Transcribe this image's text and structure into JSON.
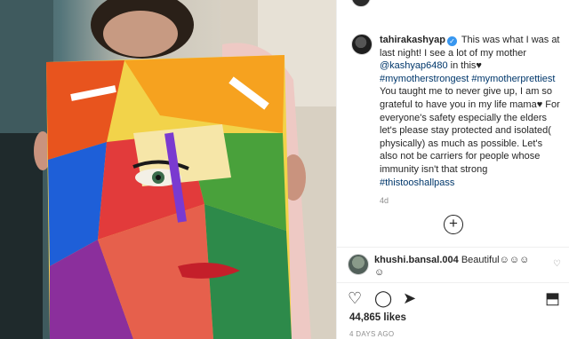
{
  "post": {
    "username": "tahirakashyap",
    "caption_parts": [
      {
        "type": "text",
        "text": " This was what I was at last night! I see a lot of my mother "
      },
      {
        "type": "link",
        "text": "@kashyap6480"
      },
      {
        "type": "text",
        "text": " in this♥ "
      },
      {
        "type": "link",
        "text": "#mymotherstrongest"
      },
      {
        "type": "text",
        "text": " "
      },
      {
        "type": "link",
        "text": "#mymotherprettiest"
      },
      {
        "type": "text",
        "text": " You taught me to never give up, I am so grateful to have you in my life mama♥ For everyone's safety especially the elders let's please stay protected and isolated( physically) as much as possible. Let's also not be carriers for people whose immunity isn't that strong "
      },
      {
        "type": "link",
        "text": "#thistooshallpass"
      }
    ],
    "time_ago": "4d",
    "load_more_icon": "+"
  },
  "comment": {
    "username": "khushi.bansal.004",
    "text": " Beautiful☺☺☺☺",
    "like_icon": "♡"
  },
  "actions": {
    "like_icon": "♡",
    "comment_icon": "◯",
    "share_icon": "➤",
    "save_icon": "⬒"
  },
  "likes_text": "44,865 likes",
  "date_text": "4 DAYS AGO",
  "colors": {
    "link": "#00376b",
    "verified": "#3897f0",
    "muted": "#8e8e8e"
  }
}
